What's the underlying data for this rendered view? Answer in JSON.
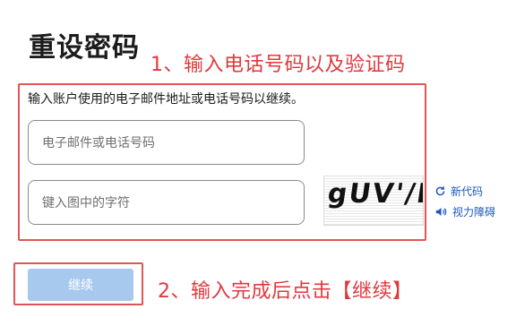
{
  "page_title": "重设密码",
  "annotations": {
    "step1": "1、输入电话号码以及验证码",
    "step2": "2、输入完成后点击【继续】"
  },
  "form": {
    "instruction": "输入账户使用的电子邮件地址或电话号码以继续。",
    "email_placeholder": "电子邮件或电话号码",
    "chars_placeholder": "键入图中的字符",
    "captcha_text": "gUV'/D",
    "new_code_label": "新代码",
    "audio_label": "视力障碍",
    "continue_label": "继续"
  },
  "colors": {
    "annotation_red": "#e0393e",
    "link_blue": "#1a56b8",
    "button_disabled": "#a8c9ee"
  },
  "icons": {
    "new_code": "refresh-icon",
    "audio": "speaker-icon"
  }
}
